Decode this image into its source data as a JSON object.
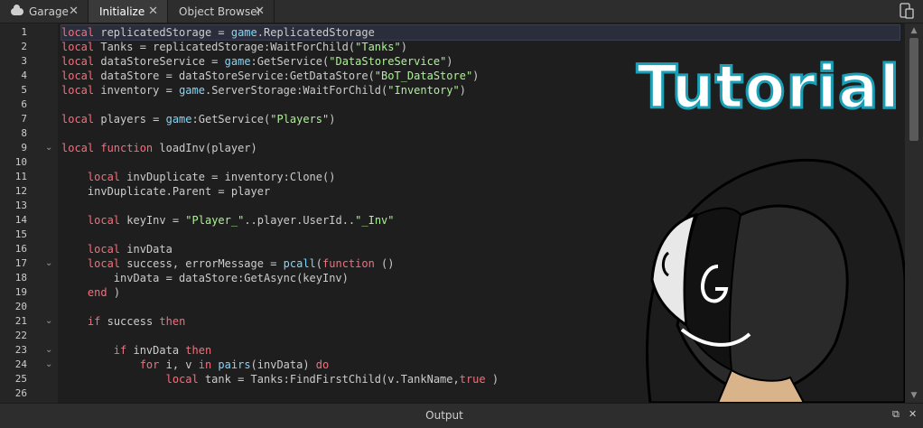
{
  "tabs": [
    {
      "label": "Garage",
      "close": "✕",
      "icon": "cloud-icon"
    },
    {
      "label": "Initialize",
      "close": "✕"
    },
    {
      "label": "Object Browser",
      "close": "✕"
    }
  ],
  "toolbar": {
    "device_icon": "device-emulator-icon"
  },
  "overlay": {
    "text": "Tutorial"
  },
  "output": {
    "title": "Output"
  },
  "code": {
    "line_numbers": [
      "1",
      "2",
      "3",
      "4",
      "5",
      "6",
      "7",
      "8",
      "9",
      "10",
      "11",
      "12",
      "13",
      "14",
      "15",
      "16",
      "17",
      "18",
      "19",
      "20",
      "21",
      "22",
      "23",
      "24",
      "25",
      "26"
    ],
    "folds": {
      "9": "v",
      "17": "v",
      "21": "v",
      "23": "v",
      "24": "v"
    },
    "lines": [
      [
        [
          "kw",
          "local"
        ],
        [
          "",
          "replicatedStorage = "
        ],
        [
          "gb",
          "game"
        ],
        [
          "",
          ".ReplicatedStorage"
        ]
      ],
      [
        [
          "kw",
          "local"
        ],
        [
          "",
          "Tanks = replicatedStorage:WaitForChild("
        ],
        [
          "str",
          "\"Tanks\""
        ],
        [
          "",
          ")"
        ]
      ],
      [
        [
          "kw",
          "local"
        ],
        [
          "",
          "dataStoreService = "
        ],
        [
          "gb",
          "game"
        ],
        [
          "",
          ":GetService("
        ],
        [
          "str",
          "\"DataStoreService\""
        ],
        [
          "",
          ")"
        ]
      ],
      [
        [
          "kw",
          "local"
        ],
        [
          "",
          "dataStore = dataStoreService:GetDataStore("
        ],
        [
          "str",
          "\"BoT_DataStore\""
        ],
        [
          "",
          ")"
        ]
      ],
      [
        [
          "kw",
          "local"
        ],
        [
          "",
          "inventory = "
        ],
        [
          "gb",
          "game"
        ],
        [
          "",
          ".ServerStorage:WaitForChild("
        ],
        [
          "str",
          "\"Inventory\""
        ],
        [
          "",
          ")"
        ]
      ],
      [],
      [
        [
          "kw",
          "local"
        ],
        [
          "",
          "players = "
        ],
        [
          "gb",
          "game"
        ],
        [
          "",
          ":GetService("
        ],
        [
          "str",
          "\"Players\""
        ],
        [
          "",
          ")"
        ]
      ],
      [],
      [
        [
          "kw",
          "local"
        ],
        [
          "",
          ""
        ],
        [
          "kw",
          "function"
        ],
        [
          "",
          "loadInv(player)"
        ]
      ],
      [],
      [
        [
          "",
          "    "
        ],
        [
          "kw",
          "local"
        ],
        [
          "",
          "invDuplicate = inventory:Clone()"
        ]
      ],
      [
        [
          "",
          "    invDuplicate.Parent = player"
        ]
      ],
      [],
      [
        [
          "",
          "    "
        ],
        [
          "kw",
          "local"
        ],
        [
          "",
          "keyInv = "
        ],
        [
          "str",
          "\"Player_\""
        ],
        [
          "",
          "..player.UserId.."
        ],
        [
          "str",
          "\"_Inv\""
        ]
      ],
      [],
      [
        [
          "",
          "    "
        ],
        [
          "kw",
          "local"
        ],
        [
          "",
          "invData"
        ]
      ],
      [
        [
          "",
          "    "
        ],
        [
          "kw",
          "local"
        ],
        [
          "",
          "success, errorMessage = "
        ],
        [
          "gb",
          "pcall"
        ],
        [
          "",
          "("
        ],
        [
          "kw",
          "function"
        ],
        [
          "",
          "()"
        ]
      ],
      [
        [
          "",
          "        invData = dataStore:GetAsync(keyInv)"
        ]
      ],
      [
        [
          "",
          "    "
        ],
        [
          "kw",
          "end"
        ],
        [
          "",
          ")"
        ]
      ],
      [],
      [
        [
          "",
          "    "
        ],
        [
          "kw",
          "if"
        ],
        [
          "",
          "success "
        ],
        [
          "kw",
          "then"
        ]
      ],
      [],
      [
        [
          "",
          "        "
        ],
        [
          "kw",
          "if"
        ],
        [
          "",
          "invData "
        ],
        [
          "kw",
          "then"
        ]
      ],
      [
        [
          "",
          "            "
        ],
        [
          "kw",
          "for"
        ],
        [
          "",
          "i, v "
        ],
        [
          "kw",
          "in"
        ],
        [
          "",
          ""
        ],
        [
          "gb",
          "pairs"
        ],
        [
          "",
          "(invData) "
        ],
        [
          "kw",
          "do"
        ]
      ],
      [
        [
          "",
          "                "
        ],
        [
          "kw",
          "local"
        ],
        [
          "",
          "tank = Tanks:FindFirstChild(v.TankName,"
        ],
        [
          "kw",
          "true"
        ],
        [
          "",
          ")"
        ]
      ],
      []
    ]
  }
}
